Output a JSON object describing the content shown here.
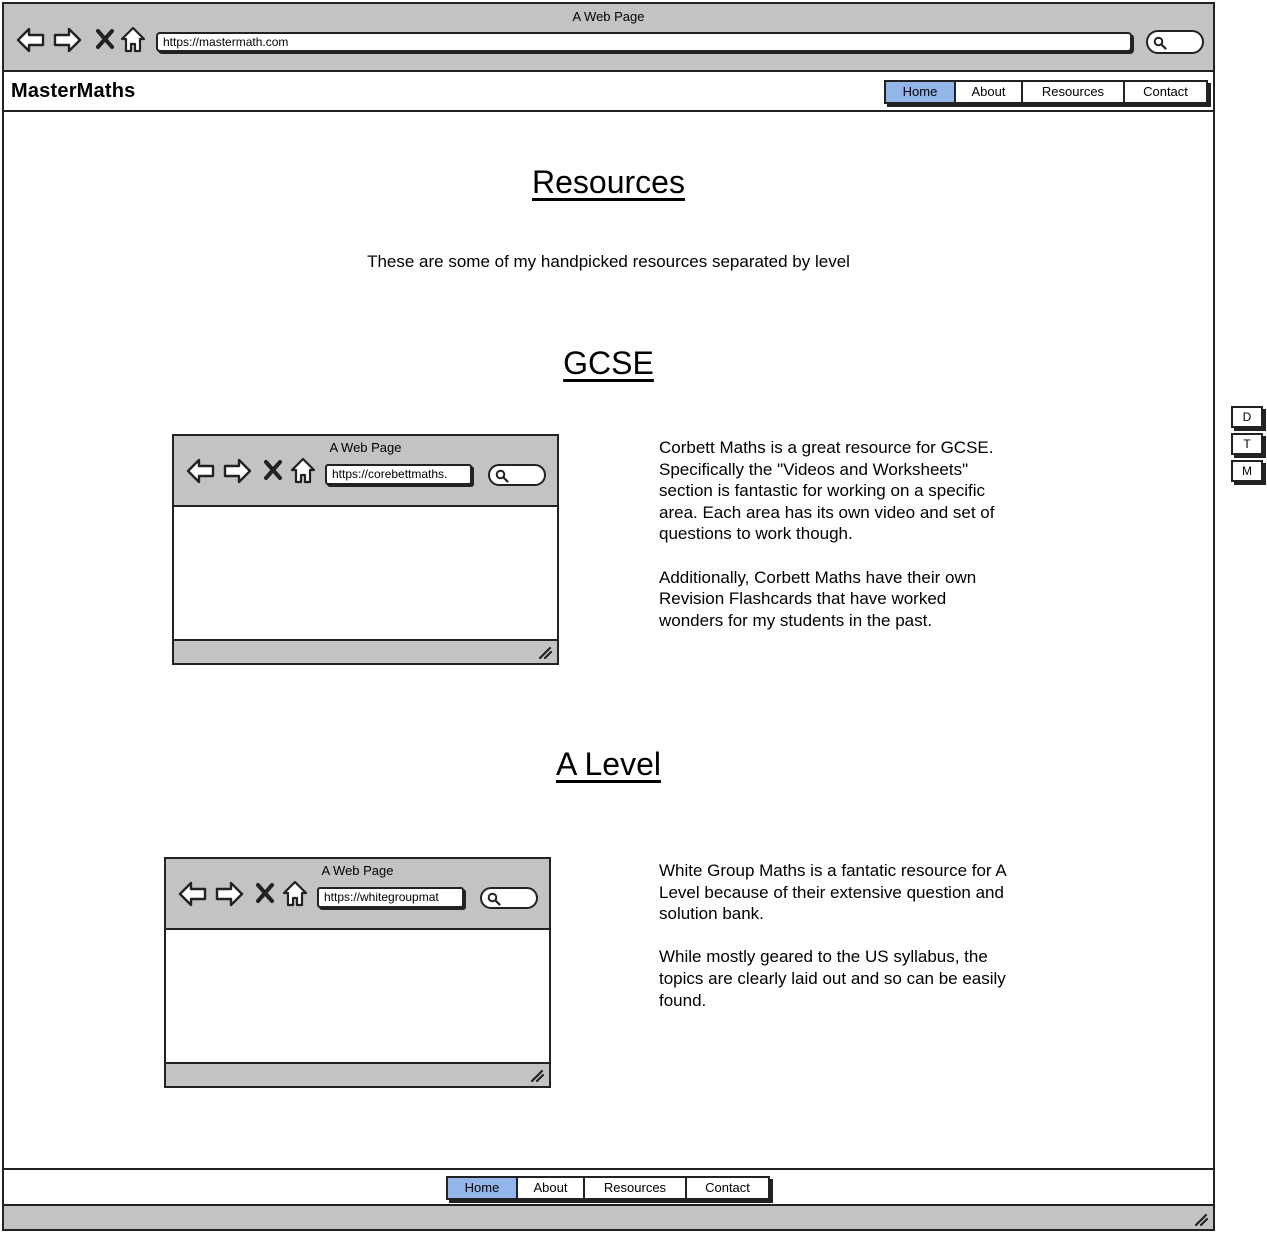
{
  "window": {
    "title": "A Web Page",
    "url": "https://mastermath.com"
  },
  "header": {
    "brand": "MasterMaths",
    "nav": [
      "Home",
      "About",
      "Resources",
      "Contact"
    ],
    "active": "Home"
  },
  "page": {
    "heading": "Resources",
    "intro": "These are some of my handpicked resources separated by level"
  },
  "sections": [
    {
      "heading": "GCSE",
      "preview_title": "A Web Page",
      "preview_url": "https://corebettmaths.",
      "paragraphs": [
        "Corbett Maths is a great resource for GCSE. Specifically the \"Videos and Worksheets\" section is fantastic for working on a specific area. Each area has its own video and set of questions to work though.",
        "Additionally, Corbett Maths have their own Revision Flashcards that have worked wonders for my students in the past."
      ]
    },
    {
      "heading": "A Level",
      "preview_title": "A Web Page",
      "preview_url": "https://whitegroupmat",
      "paragraphs": [
        "White Group Maths is a fantatic resource for A Level because of their extensive question and solution bank.",
        "While mostly geared to the US syllabus, the topics are clearly laid out and so can be easily found."
      ]
    }
  ],
  "footer": {
    "nav": [
      "Home",
      "About",
      "Resources",
      "Contact"
    ],
    "active": "Home"
  },
  "side_buttons": [
    "D",
    "T",
    "M"
  ],
  "colors": {
    "chrome": "#c3c3c3",
    "active_tab": "#94b5ea",
    "border": "#222222"
  }
}
